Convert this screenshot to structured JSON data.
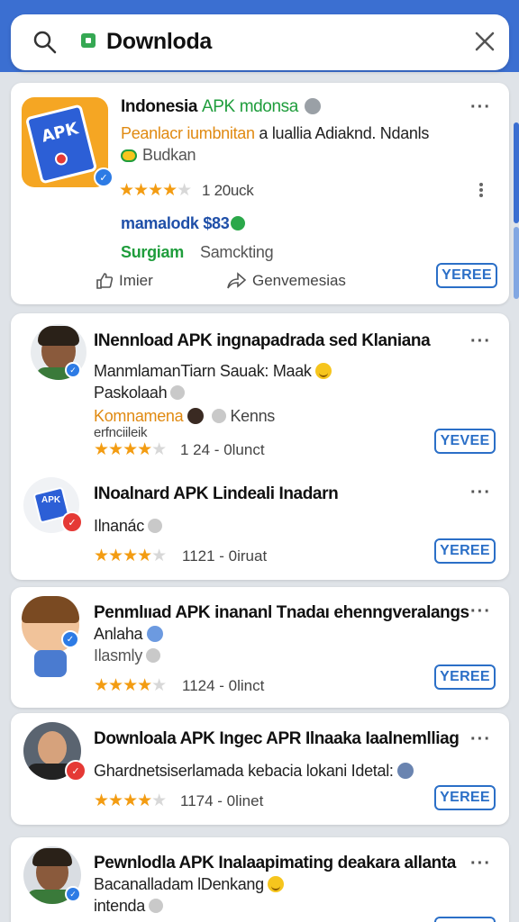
{
  "search": {
    "query": "Downloda"
  },
  "featured": {
    "title_main": "Indonesia",
    "title_highlight": "APK",
    "title_rest": "mdonsa",
    "subtitle_orange": "Peanlacr iumbnitan",
    "subtitle_rest": "a luallia Adiaknd. Ndanls",
    "badge_text": "Budkan",
    "rating_value": "1 20uck",
    "stars": 4,
    "dev_name": "mamalodk $83",
    "category": "Surgiam",
    "category_note": "Samckting",
    "like_label": "Imier",
    "share_label": "Genvemesias",
    "button_label": "YEREE"
  },
  "results": [
    {
      "title": "INennload APK ingnapadrada sed Klaniana",
      "line1": "ManmlamanTiarn Sauak: Maak",
      "line2": "Paskolaah",
      "line3_orange": "Komnamena",
      "line3_rest": "Kenns",
      "line4": "erfnciileik",
      "meta": "1 24 - 0lunct",
      "stars": 4,
      "button_label": "YEVEE"
    },
    {
      "title": "INoalnard APK Lindeali Inadarn",
      "line1": "Ilnanác",
      "meta": "1121 - 0iruat",
      "stars": 4,
      "button_label": "YEREE"
    },
    {
      "title": "Penmlııad APK inananl Tnadaı ehenngveralangs",
      "line1": "Anlaha",
      "line2": "Ilasmly",
      "meta": "1124 - 0linct",
      "stars": 4,
      "button_label": "YEREE"
    },
    {
      "title": "Downloala APK Ingec APR Ilnaaka Iaalnemlliag",
      "line1": "Ghardnetsiserlamada kebacia lokani Idetal:",
      "meta": "1174 - 0linet",
      "stars": 4,
      "button_label": "YEREE"
    },
    {
      "title": "Pewnlodla APK Inalaapimating deakara allanta",
      "line1": "Bacanalladam lDenkang",
      "line2": "intenda"
    }
  ],
  "colors": {
    "accent": "#3b6fd1",
    "button": "#2b6fc7",
    "highlight_green": "#1f9d3c",
    "orange": "#e08a12",
    "star": "#f39c12"
  }
}
